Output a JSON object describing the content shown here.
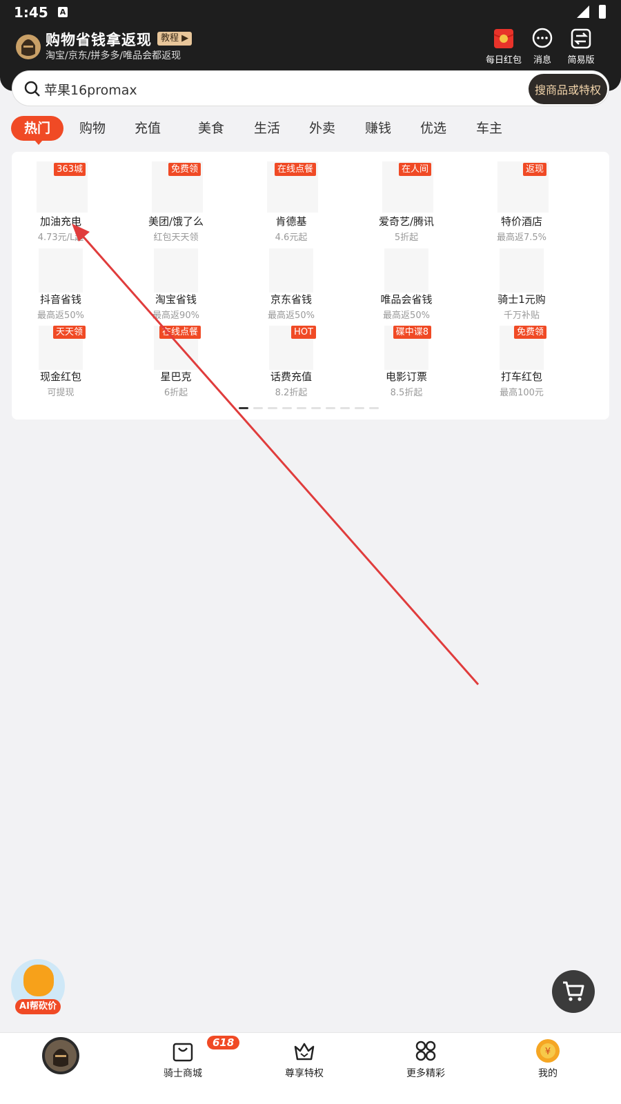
{
  "status_bar": {
    "time": "1:45",
    "a_icon": "A"
  },
  "header": {
    "title": "购物省钱拿返现",
    "tutorial": "教程",
    "subtitle": "淘宝/京东/拼多多/唯品会都返现",
    "buttons": [
      {
        "label": "每日红包",
        "icon": "red-envelope-icon"
      },
      {
        "label": "消息",
        "icon": "message-icon"
      },
      {
        "label": "简易版",
        "icon": "switch-icon"
      }
    ]
  },
  "search": {
    "value": "苹果16promax",
    "button": "搜商品或特权"
  },
  "tabs": [
    "热门",
    "购物",
    "充值",
    "美食",
    "生活",
    "外卖",
    "赚钱",
    "优选",
    "车主"
  ],
  "grid": {
    "row1": [
      {
        "badge": "363城",
        "name": "加油充电",
        "sub": "4.73元/L起"
      },
      {
        "badge": "免费领",
        "name": "美团/饿了么",
        "sub": "红包天天领"
      },
      {
        "badge": "在线点餐",
        "name": "肯德基",
        "sub": "4.6元起"
      },
      {
        "badge": "在人间",
        "name": "爱奇艺/腾讯",
        "sub": "5折起"
      },
      {
        "badge": "返现",
        "name": "特价酒店",
        "sub": "最高返7.5%"
      }
    ],
    "row2": [
      {
        "name": "抖音省钱",
        "sub": "最高返50%"
      },
      {
        "name": "淘宝省钱",
        "sub": "最高返90%"
      },
      {
        "name": "京东省钱",
        "sub": "最高返50%"
      },
      {
        "name": "唯品会省钱",
        "sub": "最高返50%"
      },
      {
        "name": "骑士1元购",
        "sub": "千万补贴"
      }
    ],
    "row3": [
      {
        "badge": "天天领",
        "name": "现金红包",
        "sub": "可提现"
      },
      {
        "badge": "在线点餐",
        "name": "星巴克",
        "sub": "6折起"
      },
      {
        "badge": "HOT",
        "name": "话费充值",
        "sub": "8.2折起"
      },
      {
        "badge": "碟中谍8",
        "name": "电影订票",
        "sub": "8.5折起"
      },
      {
        "badge": "免费领",
        "name": "打车红包",
        "sub": "最高100元"
      }
    ],
    "page_count": 10,
    "active_page": 1
  },
  "ai_float": {
    "label": "AI帮砍价"
  },
  "bottom_nav": {
    "items": [
      {
        "label": "",
        "icon": "knight-logo-icon"
      },
      {
        "label": "骑士商城",
        "icon": "shopping-bag-icon"
      },
      {
        "label": "尊享特权",
        "icon": "crown-icon"
      },
      {
        "label": "更多精彩",
        "icon": "grid-icon"
      },
      {
        "label": "我的",
        "icon": "coin-avatar-icon"
      }
    ],
    "badge": "618"
  },
  "colors": {
    "accent": "#f04a25",
    "header_bg": "#1e1e1e",
    "gold": "#e8c69a"
  }
}
